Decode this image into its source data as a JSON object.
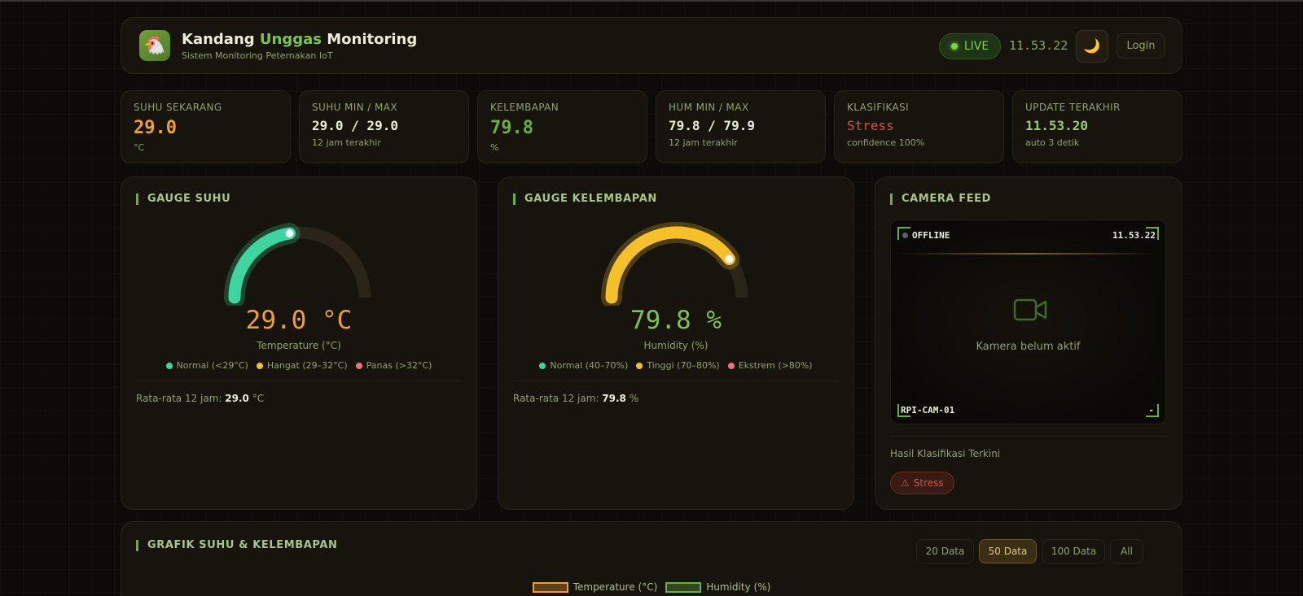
{
  "app": {
    "title_prefix": "Kandang ",
    "title_accent": "Unggas",
    "title_suffix": " Monitoring",
    "subtitle": "Sistem Monitoring Peternakan IoT",
    "logo_icon": "chicken-icon"
  },
  "header": {
    "live_label": "LIVE",
    "time": "11.53.22",
    "theme_icon": "moon-icon",
    "login_label": "Login"
  },
  "stats": [
    {
      "label": "SUHU SEKARANG",
      "value": "29.0",
      "sub": "°C",
      "color": "#f0a030"
    },
    {
      "label": "SUHU MIN / MAX",
      "value": "29.0 / 29.0",
      "sub": "12 jam terakhir",
      "color": "#e8eed8"
    },
    {
      "label": "KELEMBAPAN",
      "value": "79.8",
      "sub": "%",
      "color": "#6ab03c"
    },
    {
      "label": "HUM MIN / MAX",
      "value": "79.8 / 79.9",
      "sub": "12 jam terakhir",
      "color": "#e8eed8"
    },
    {
      "label": "KLASIFIKASI",
      "value": "Stress",
      "sub": "confidence 100%",
      "color": "#e0503a"
    },
    {
      "label": "UPDATE TERAKHIR",
      "value": "11.53.20",
      "sub": "auto 3 detik",
      "color": "#9cc870"
    }
  ],
  "gauge_temp": {
    "title": "GAUGE SUHU",
    "value_text": "29.0 °C",
    "value": 29.0,
    "min": 20,
    "max": 40,
    "label": "Temperature (°C)",
    "color": "#3ed6a0",
    "legend": [
      {
        "label": "Normal (<29°C)",
        "color": "#3ed6a0"
      },
      {
        "label": "Hangat (29–32°C)",
        "color": "#f2c02c"
      },
      {
        "label": "Panas (>32°C)",
        "color": "#f07080"
      }
    ],
    "avg_prefix": "Rata-rata 12 jam: ",
    "avg_value": "29.0",
    "avg_unit": " °C"
  },
  "gauge_hum": {
    "title": "GAUGE KELEMBAPAN",
    "value_text": "79.8 %",
    "value": 79.8,
    "min": 0,
    "max": 100,
    "label": "Humidity (%)",
    "color": "#f5c02a",
    "legend": [
      {
        "label": "Normal (40–70%)",
        "color": "#3ed6a0"
      },
      {
        "label": "Tinggi (70–80%)",
        "color": "#f2c02c"
      },
      {
        "label": "Ekstrem (>80%)",
        "color": "#f07080"
      }
    ],
    "avg_prefix": "Rata-rata 12 jam: ",
    "avg_value": "79.8",
    "avg_unit": " %"
  },
  "camera": {
    "title": "CAMERA FEED",
    "status": "OFFLINE",
    "time": "11.53.22",
    "message": "Kamera belum aktif",
    "camera_id": "RPI-CAM-01",
    "right_text": "-",
    "icon": "video-camera-icon",
    "class_label": "Hasil Klasifikasi Terkini",
    "class_badge": "Stress",
    "badge_icon": "warning-icon"
  },
  "chart": {
    "title": "GRAFIK SUHU & KELEMBAPAN",
    "ranges": [
      "20 Data",
      "50 Data",
      "100 Data",
      "All"
    ],
    "active_range": "50 Data",
    "legend": [
      {
        "label": "Temperature (°C)",
        "color": "#f0a030"
      },
      {
        "label": "Humidity (%)",
        "color": "#6ab03c"
      }
    ]
  }
}
